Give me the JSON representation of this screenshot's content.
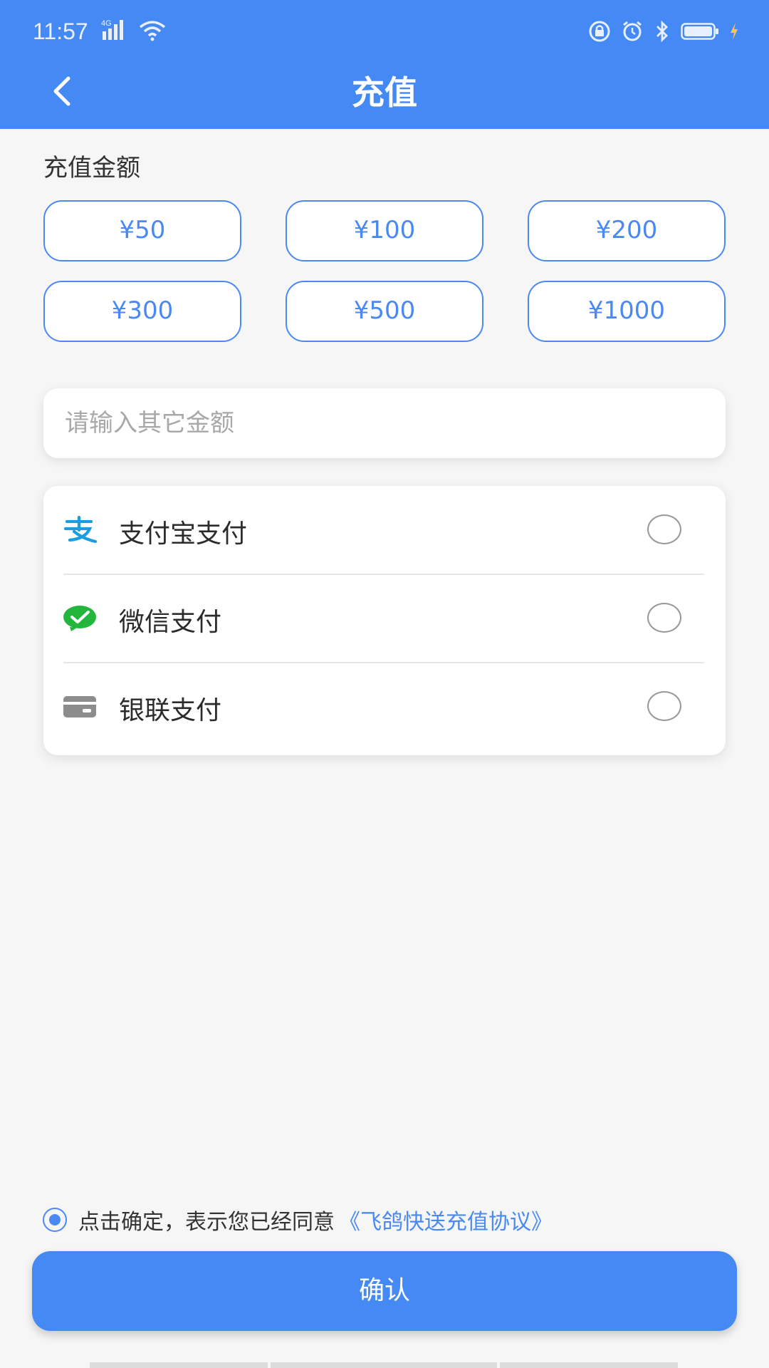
{
  "status_bar": {
    "time": "11:57",
    "network": "4G",
    "icons": [
      "signal-icon",
      "wifi-icon",
      "lock-rotation-icon",
      "alarm-icon",
      "bluetooth-icon",
      "battery-icon",
      "charging-icon"
    ]
  },
  "header": {
    "title": "充值",
    "back_icon": "back-arrow-icon",
    "bg_color": "#4589f5"
  },
  "amount_section": {
    "label": "充值金额",
    "options": [
      "¥50",
      "¥100",
      "¥200",
      "¥300",
      "¥500",
      "¥1000"
    ]
  },
  "custom_amount": {
    "placeholder": "请输入其它金额",
    "value": ""
  },
  "payment_methods": [
    {
      "label": "支付宝支付",
      "icon": "alipay-icon",
      "selected": false
    },
    {
      "label": "微信支付",
      "icon": "wechat-pay-icon",
      "selected": false
    },
    {
      "label": "银联支付",
      "icon": "bank-card-icon",
      "selected": false
    }
  ],
  "agreement": {
    "checked": true,
    "text": "点击确定，表示您已经同意",
    "link": "《飞鸽快送充值协议》"
  },
  "confirm": {
    "label": "确认"
  },
  "colors": {
    "accent": "#4a89f3",
    "background": "#f6f6f6"
  }
}
